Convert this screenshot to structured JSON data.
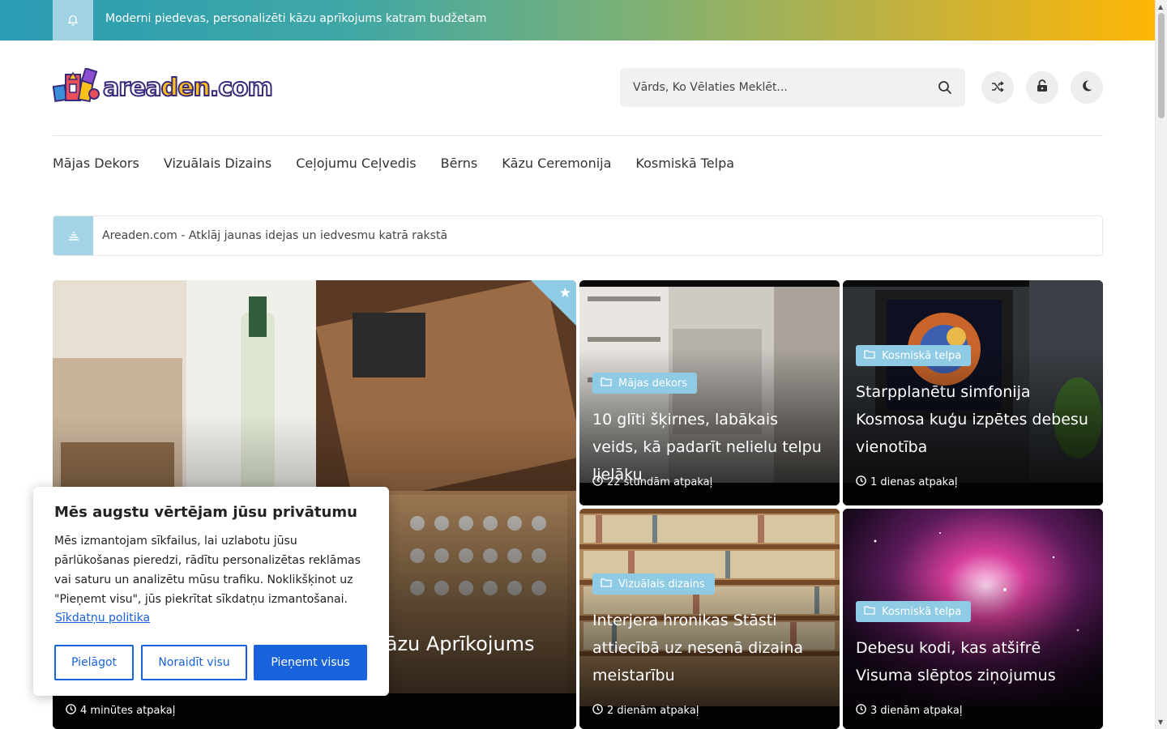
{
  "topbar": {
    "text": "Moderni piedevas, personalizēti kāzu aprīkojums katram budžetam",
    "icon": "bell-icon"
  },
  "header": {
    "logo_text_a": "area",
    "logo_text_b": "den",
    "logo_text_c": ".com",
    "search_placeholder": "Vārds, Ko Vēlaties Meklēt...",
    "buttons": [
      "shuffle-icon",
      "lock-icon",
      "moon-icon"
    ]
  },
  "nav": {
    "items": [
      "Mājas Dekors",
      "Vizuālais Dizains",
      "Ceļojumu Ceļvedis",
      "Bērns",
      "Kāzu Ceremonija",
      "Kosmiskā Telpa"
    ]
  },
  "notice": {
    "text": "Areaden.com - Atklāj jaunas idejas un iedvesmu katrā rakstā"
  },
  "posts": {
    "featured": {
      "title": "Kāzu Aprīkojums",
      "time": "4 minūtes atpakaļ"
    },
    "p1": {
      "category": "Mājas dekors",
      "title": "10 glīti šķirnes, labākais veids, kā padarīt nelielu telpu lielāku",
      "time": "22 stundām atpakaļ"
    },
    "p2": {
      "category": "Kosmiskā telpa",
      "title": "Starpplanētu simfonija Kosmosa kuģu izpētes debesu vienotība",
      "time": "1 dienas atpakaļ"
    },
    "p3": {
      "category": "Vizuālais dizains",
      "title": "Interjera hronikas Stāsti attiecībā uz nesenā dizaina meistarību",
      "time": "2 dienām atpakaļ"
    },
    "p4": {
      "category": "Kosmiskā telpa",
      "title": "Debesu kodi, kas atšifrē Visuma slēptos ziņojumus",
      "time": "3 dienām atpakaļ"
    }
  },
  "cookie": {
    "title": "Mēs augstu vērtējam jūsu privātumu",
    "body": "Mēs izmantojam sīkfailus, lai uzlabotu jūsu pārlūkošanas pieredzi, rādītu personalizētas reklāmas vai saturu un analizētu mūsu trafiku. Noklikšķinot uz \"Pieņemt visu\", jūs piekrītat sīkdatņu izmantošanai.",
    "policy_link": "Sīkdatņu politika",
    "btn_customize": "Pielāgot",
    "btn_reject": "Noraidīt visu",
    "btn_accept": "Pieņemt visus"
  },
  "colors": {
    "accent": "#8fcbe4",
    "primary_button": "#1863dc"
  }
}
